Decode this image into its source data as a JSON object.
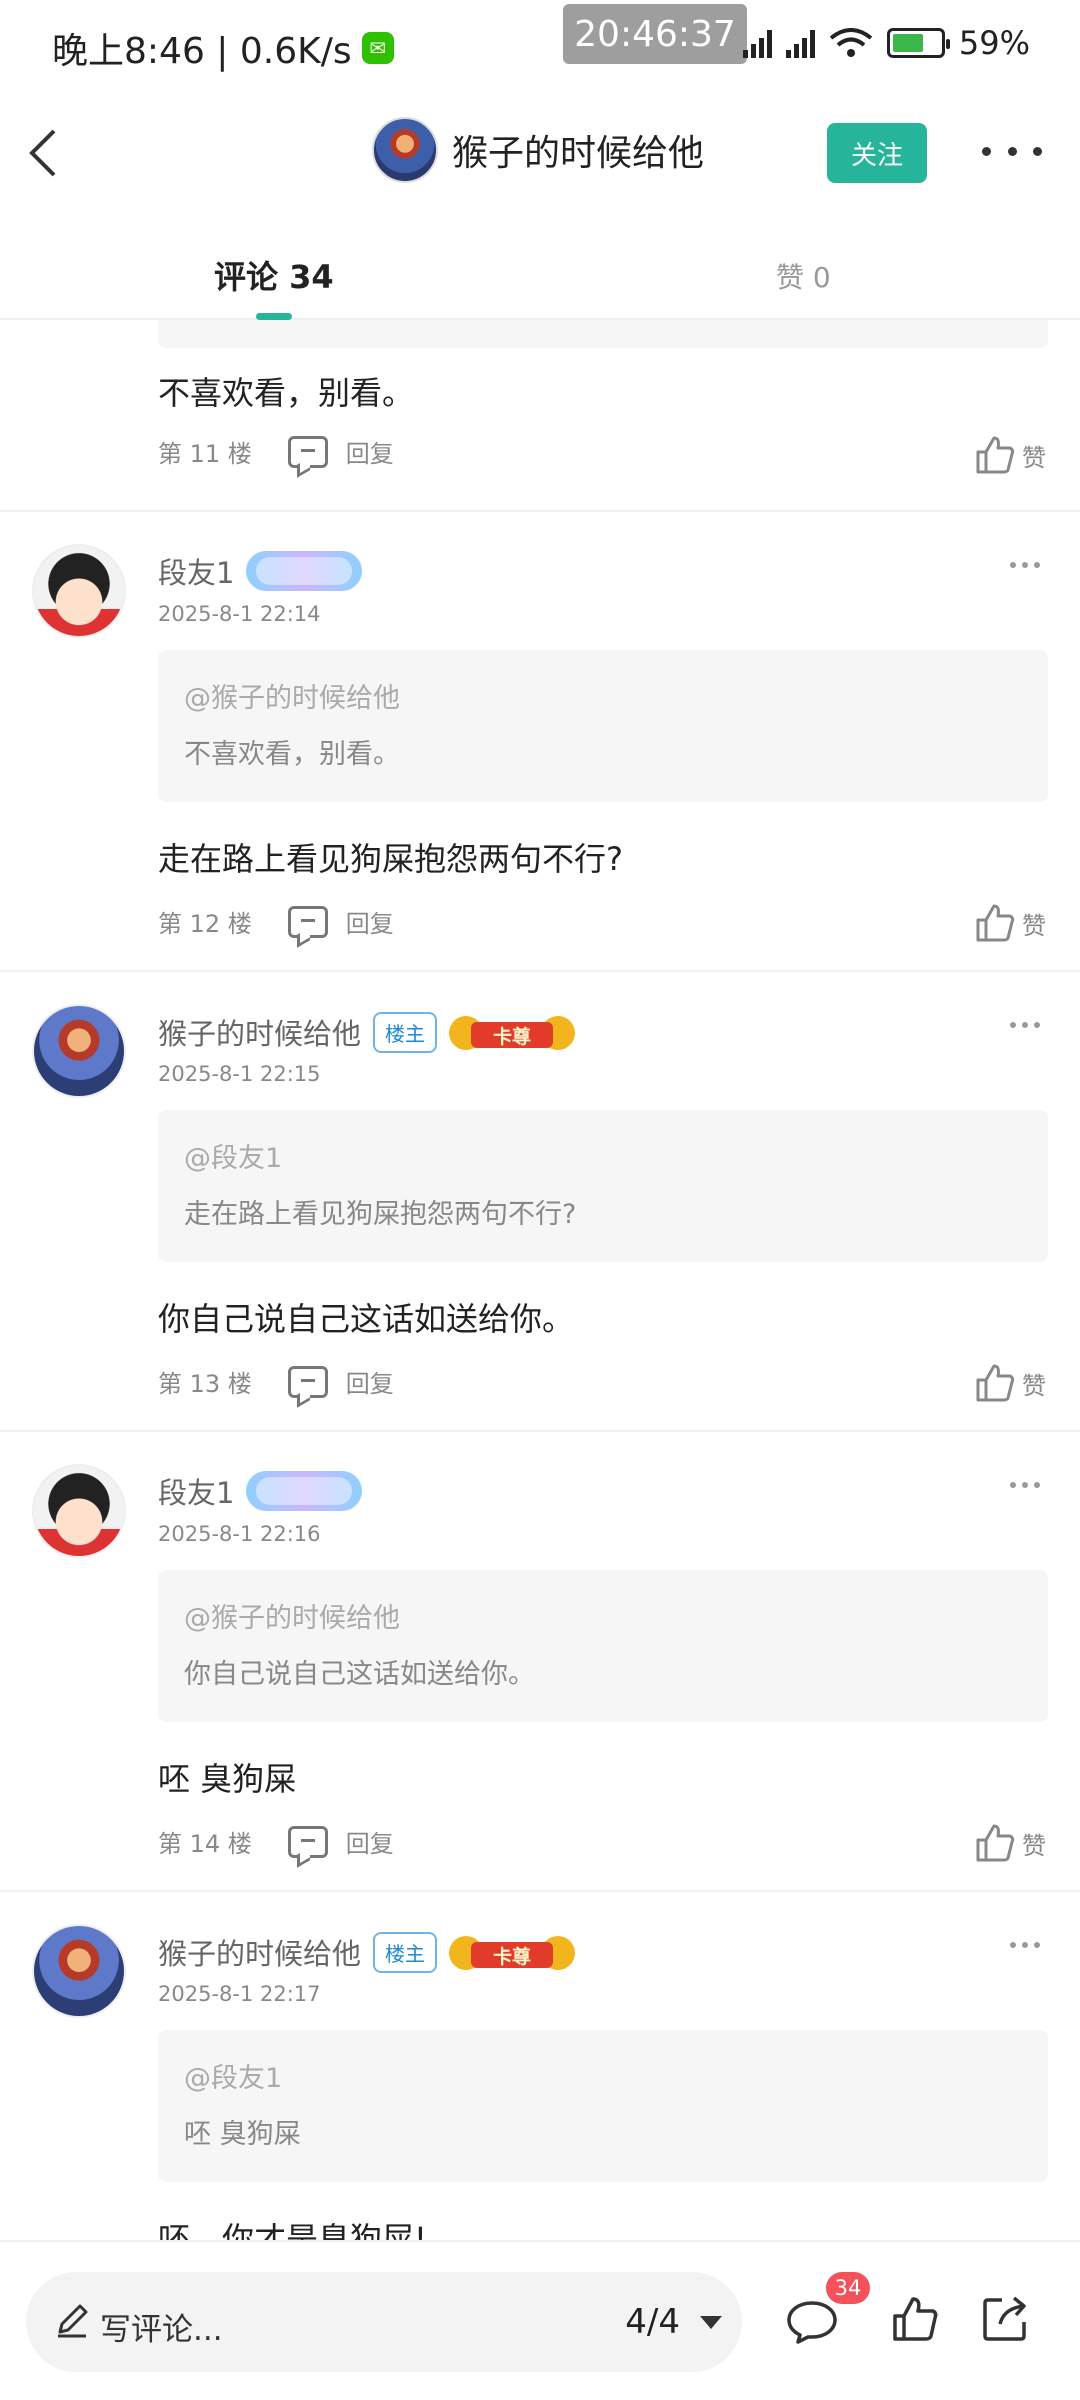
{
  "status_bar": {
    "left_text": "晚上8:46 | 0.6K/s",
    "time_overlay": "20:46:37",
    "battery": "59%"
  },
  "header": {
    "title": "猴子的时候给他",
    "follow_label": "关注"
  },
  "tabs": {
    "comments_label": "评论 34",
    "likes_label": "赞 0"
  },
  "top_comment": {
    "text": "不喜欢看，别看。",
    "floor": "第 11 楼",
    "reply_label": "回复",
    "like_label": "赞"
  },
  "comments": [
    {
      "name": "段友1",
      "date": "2025-8-1 22:14",
      "quote_at": "@猴子的时候给他",
      "quote_text": "不喜欢看，别看。",
      "text": "走在路上看见狗屎抱怨两句不行?",
      "floor": "第 12 楼",
      "reply_label": "回复",
      "like_label": "赞"
    },
    {
      "name": "猴子的时候给他",
      "owner_badge": "楼主",
      "card_badge": "卡尊",
      "date": "2025-8-1 22:15",
      "quote_at": "@段友1",
      "quote_text": "走在路上看见狗屎抱怨两句不行?",
      "text": "你自己说自己这话如送给你。",
      "floor": "第 13 楼",
      "reply_label": "回复",
      "like_label": "赞"
    },
    {
      "name": "段友1",
      "date": "2025-8-1 22:16",
      "quote_at": "@猴子的时候给他",
      "quote_text": "你自己说自己这话如送给你。",
      "text": "呸 臭狗屎",
      "floor": "第 14 楼",
      "reply_label": "回复",
      "like_label": "赞"
    },
    {
      "name": "猴子的时候给他",
      "owner_badge": "楼主",
      "card_badge": "卡尊",
      "date": "2025-8-1 22:17",
      "quote_at": "@段友1",
      "quote_text": "呸 臭狗屎",
      "text": "呸，你才是臭狗屎!"
    }
  ],
  "bottom_bar": {
    "write_placeholder": "写评论...",
    "page_indicator": "4/4",
    "comment_count": "34"
  },
  "colors": {
    "accent": "#26b59a",
    "badge_red": "#f4515a",
    "owner_blue": "#1d8ad6"
  }
}
